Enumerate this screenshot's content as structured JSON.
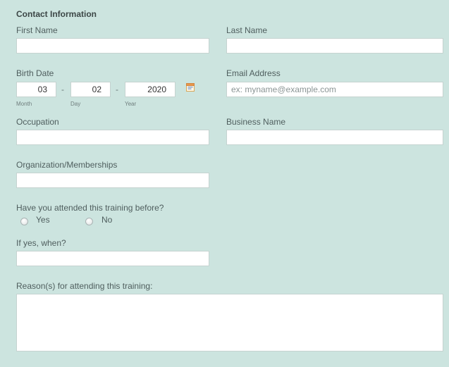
{
  "section_title": "Contact Information",
  "fields": {
    "first_name": {
      "label": "First Name",
      "value": ""
    },
    "last_name": {
      "label": "Last Name",
      "value": ""
    },
    "birth_date": {
      "label": "Birth Date",
      "month": "03",
      "day": "02",
      "year": "2020",
      "separator": "-",
      "month_label": "Month",
      "day_label": "Day",
      "year_label": "Year"
    },
    "email": {
      "label": "Email Address",
      "placeholder": "ex: myname@example.com",
      "value": ""
    },
    "occupation": {
      "label": "Occupation",
      "value": ""
    },
    "business_name": {
      "label": "Business Name",
      "value": ""
    },
    "organization": {
      "label": "Organization/Memberships",
      "value": ""
    },
    "attended": {
      "label": "Have you attended this training before?",
      "options": [
        "Yes",
        "No"
      ]
    },
    "if_yes_when": {
      "label": "If yes, when?",
      "value": ""
    },
    "reasons": {
      "label": "Reason(s) for attending this training:",
      "value": ""
    }
  },
  "icons": {
    "calendar": "calendar-icon"
  },
  "colors": {
    "background": "#cce4df",
    "input_bg": "#ffffff",
    "input_border": "#c5d3d0"
  }
}
